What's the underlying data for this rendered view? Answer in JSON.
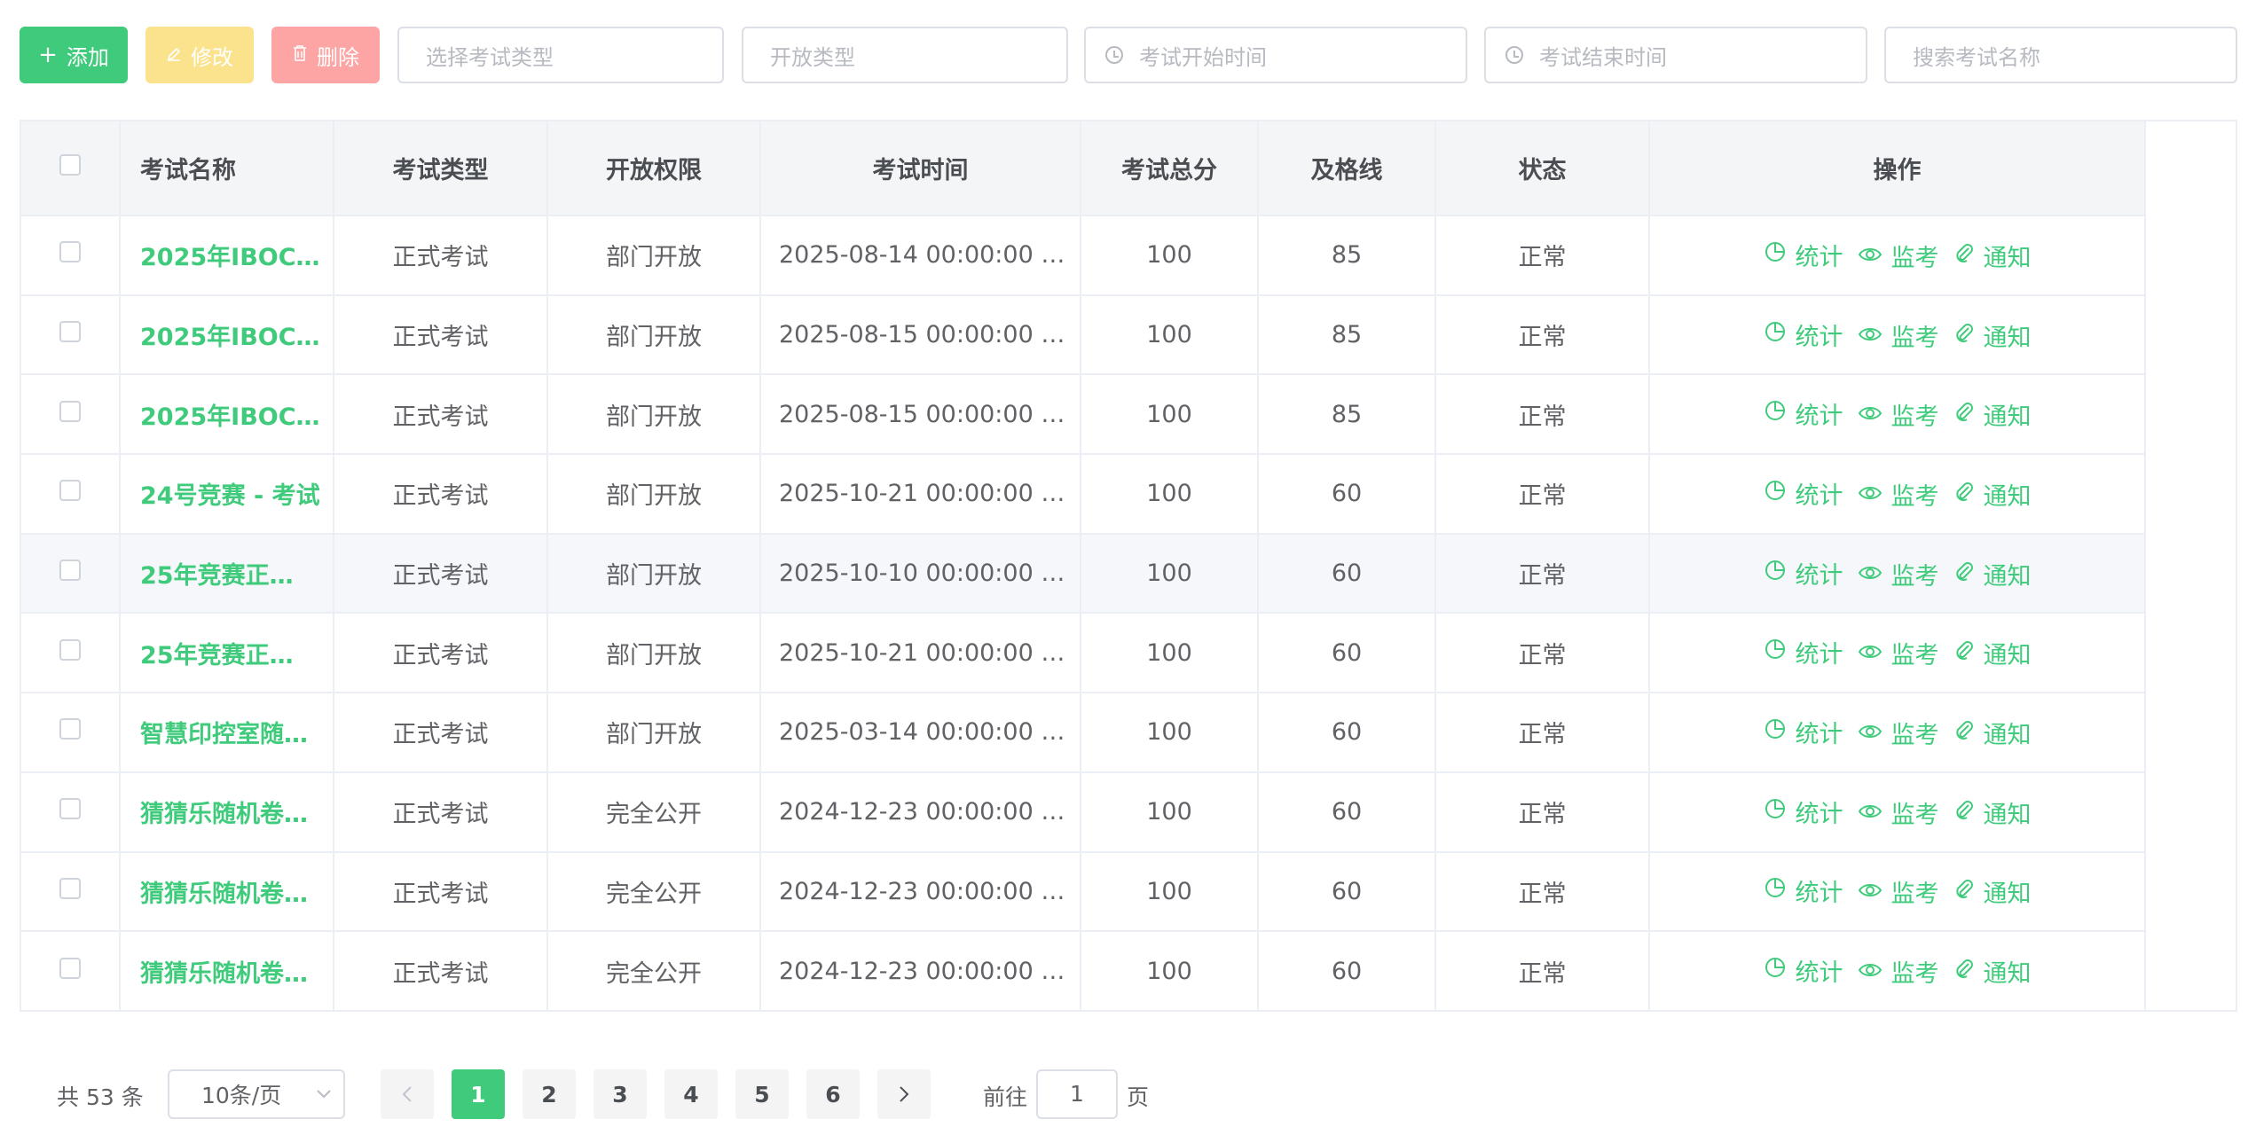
{
  "toolbar": {
    "add_label": "添加",
    "edit_label": "修改",
    "delete_label": "删除",
    "type_placeholder": "选择考试类型",
    "open_placeholder": "开放类型",
    "start_placeholder": "考试开始时间",
    "end_placeholder": "考试结束时间",
    "search_placeholder": "搜索考试名称"
  },
  "table": {
    "headers": {
      "name": "考试名称",
      "type": "考试类型",
      "permission": "开放权限",
      "time": "考试时间",
      "total": "考试总分",
      "pass": "及格线",
      "status": "状态",
      "actions": "操作"
    },
    "actions": {
      "stats": "统计",
      "monitor": "监考",
      "notify": "通知"
    },
    "rows": [
      {
        "name": "2025年IBOC…",
        "type": "正式考试",
        "permission": "部门开放",
        "time": "2025-08-14 00:00:00 ~…",
        "total": "100",
        "pass": "85",
        "status": "正常"
      },
      {
        "name": "2025年IBOC…",
        "type": "正式考试",
        "permission": "部门开放",
        "time": "2025-08-15 00:00:00 ~…",
        "total": "100",
        "pass": "85",
        "status": "正常"
      },
      {
        "name": "2025年IBOC…",
        "type": "正式考试",
        "permission": "部门开放",
        "time": "2025-08-15 00:00:00 ~…",
        "total": "100",
        "pass": "85",
        "status": "正常"
      },
      {
        "name": "24号竞赛 - 考试",
        "type": "正式考试",
        "permission": "部门开放",
        "time": "2025-10-21 00:00:00 ~…",
        "total": "100",
        "pass": "60",
        "status": "正常"
      },
      {
        "name": "25年竞赛正…",
        "type": "正式考试",
        "permission": "部门开放",
        "time": "2025-10-10 00:00:00 ~…",
        "total": "100",
        "pass": "60",
        "status": "正常"
      },
      {
        "name": "25年竞赛正…",
        "type": "正式考试",
        "permission": "部门开放",
        "time": "2025-10-21 00:00:00 ~…",
        "total": "100",
        "pass": "60",
        "status": "正常"
      },
      {
        "name": "智慧印控室随…",
        "type": "正式考试",
        "permission": "部门开放",
        "time": "2025-03-14 00:00:00 ~…",
        "total": "100",
        "pass": "60",
        "status": "正常"
      },
      {
        "name": "猜猜乐随机卷…",
        "type": "正式考试",
        "permission": "完全公开",
        "time": "2024-12-23 00:00:00 ~…",
        "total": "100",
        "pass": "60",
        "status": "正常"
      },
      {
        "name": "猜猜乐随机卷…",
        "type": "正式考试",
        "permission": "完全公开",
        "time": "2024-12-23 00:00:00 ~…",
        "total": "100",
        "pass": "60",
        "status": "正常"
      },
      {
        "name": "猜猜乐随机卷…",
        "type": "正式考试",
        "permission": "完全公开",
        "time": "2024-12-23 00:00:00 ~…",
        "total": "100",
        "pass": "60",
        "status": "正常"
      }
    ]
  },
  "pagination": {
    "total_label": "共 53 条",
    "page_size": "10条/页",
    "pages": [
      "1",
      "2",
      "3",
      "4",
      "5",
      "6"
    ],
    "current_page": "1",
    "goto_prefix": "前往",
    "goto_value": "1",
    "goto_suffix": "页"
  },
  "colors": {
    "accent": "#3fcb7b",
    "edit": "#fbe28d",
    "delete": "#fda4a4",
    "header_bg": "#f3f5f7"
  }
}
